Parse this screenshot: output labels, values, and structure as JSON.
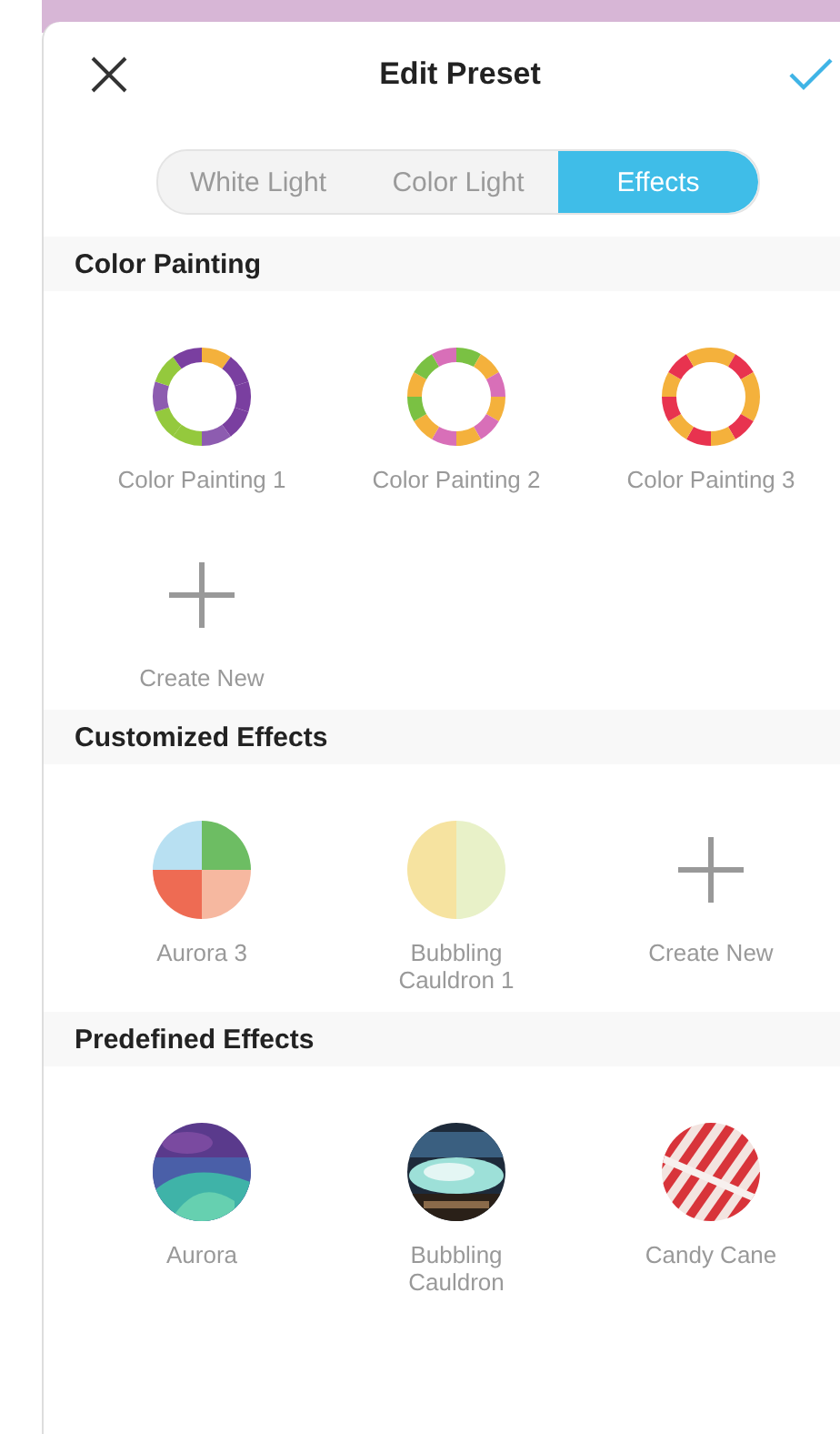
{
  "header": {
    "title": "Edit Preset"
  },
  "tabs": [
    {
      "label": "White Light",
      "selected": false
    },
    {
      "label": "Color Light",
      "selected": false
    },
    {
      "label": "Effects",
      "selected": true
    }
  ],
  "sections": [
    {
      "title": "Color Painting",
      "items": [
        {
          "kind": "ring",
          "label": "Color Painting 1"
        },
        {
          "kind": "ring",
          "label": "Color Painting 2"
        },
        {
          "kind": "ring",
          "label": "Color Painting 3"
        },
        {
          "kind": "plus",
          "label": "Create New"
        }
      ]
    },
    {
      "title": "Customized Effects",
      "items": [
        {
          "kind": "pie",
          "label": "Aurora 3"
        },
        {
          "kind": "pie",
          "label": "Bubbling Cauldron 1"
        },
        {
          "kind": "plus",
          "label": "Create New"
        }
      ]
    },
    {
      "title": "Predefined Effects",
      "items": [
        {
          "kind": "picture",
          "label": "Aurora"
        },
        {
          "kind": "picture",
          "label": "Bubbling Cauldron"
        },
        {
          "kind": "picture",
          "label": "Candy Cane"
        }
      ]
    }
  ]
}
